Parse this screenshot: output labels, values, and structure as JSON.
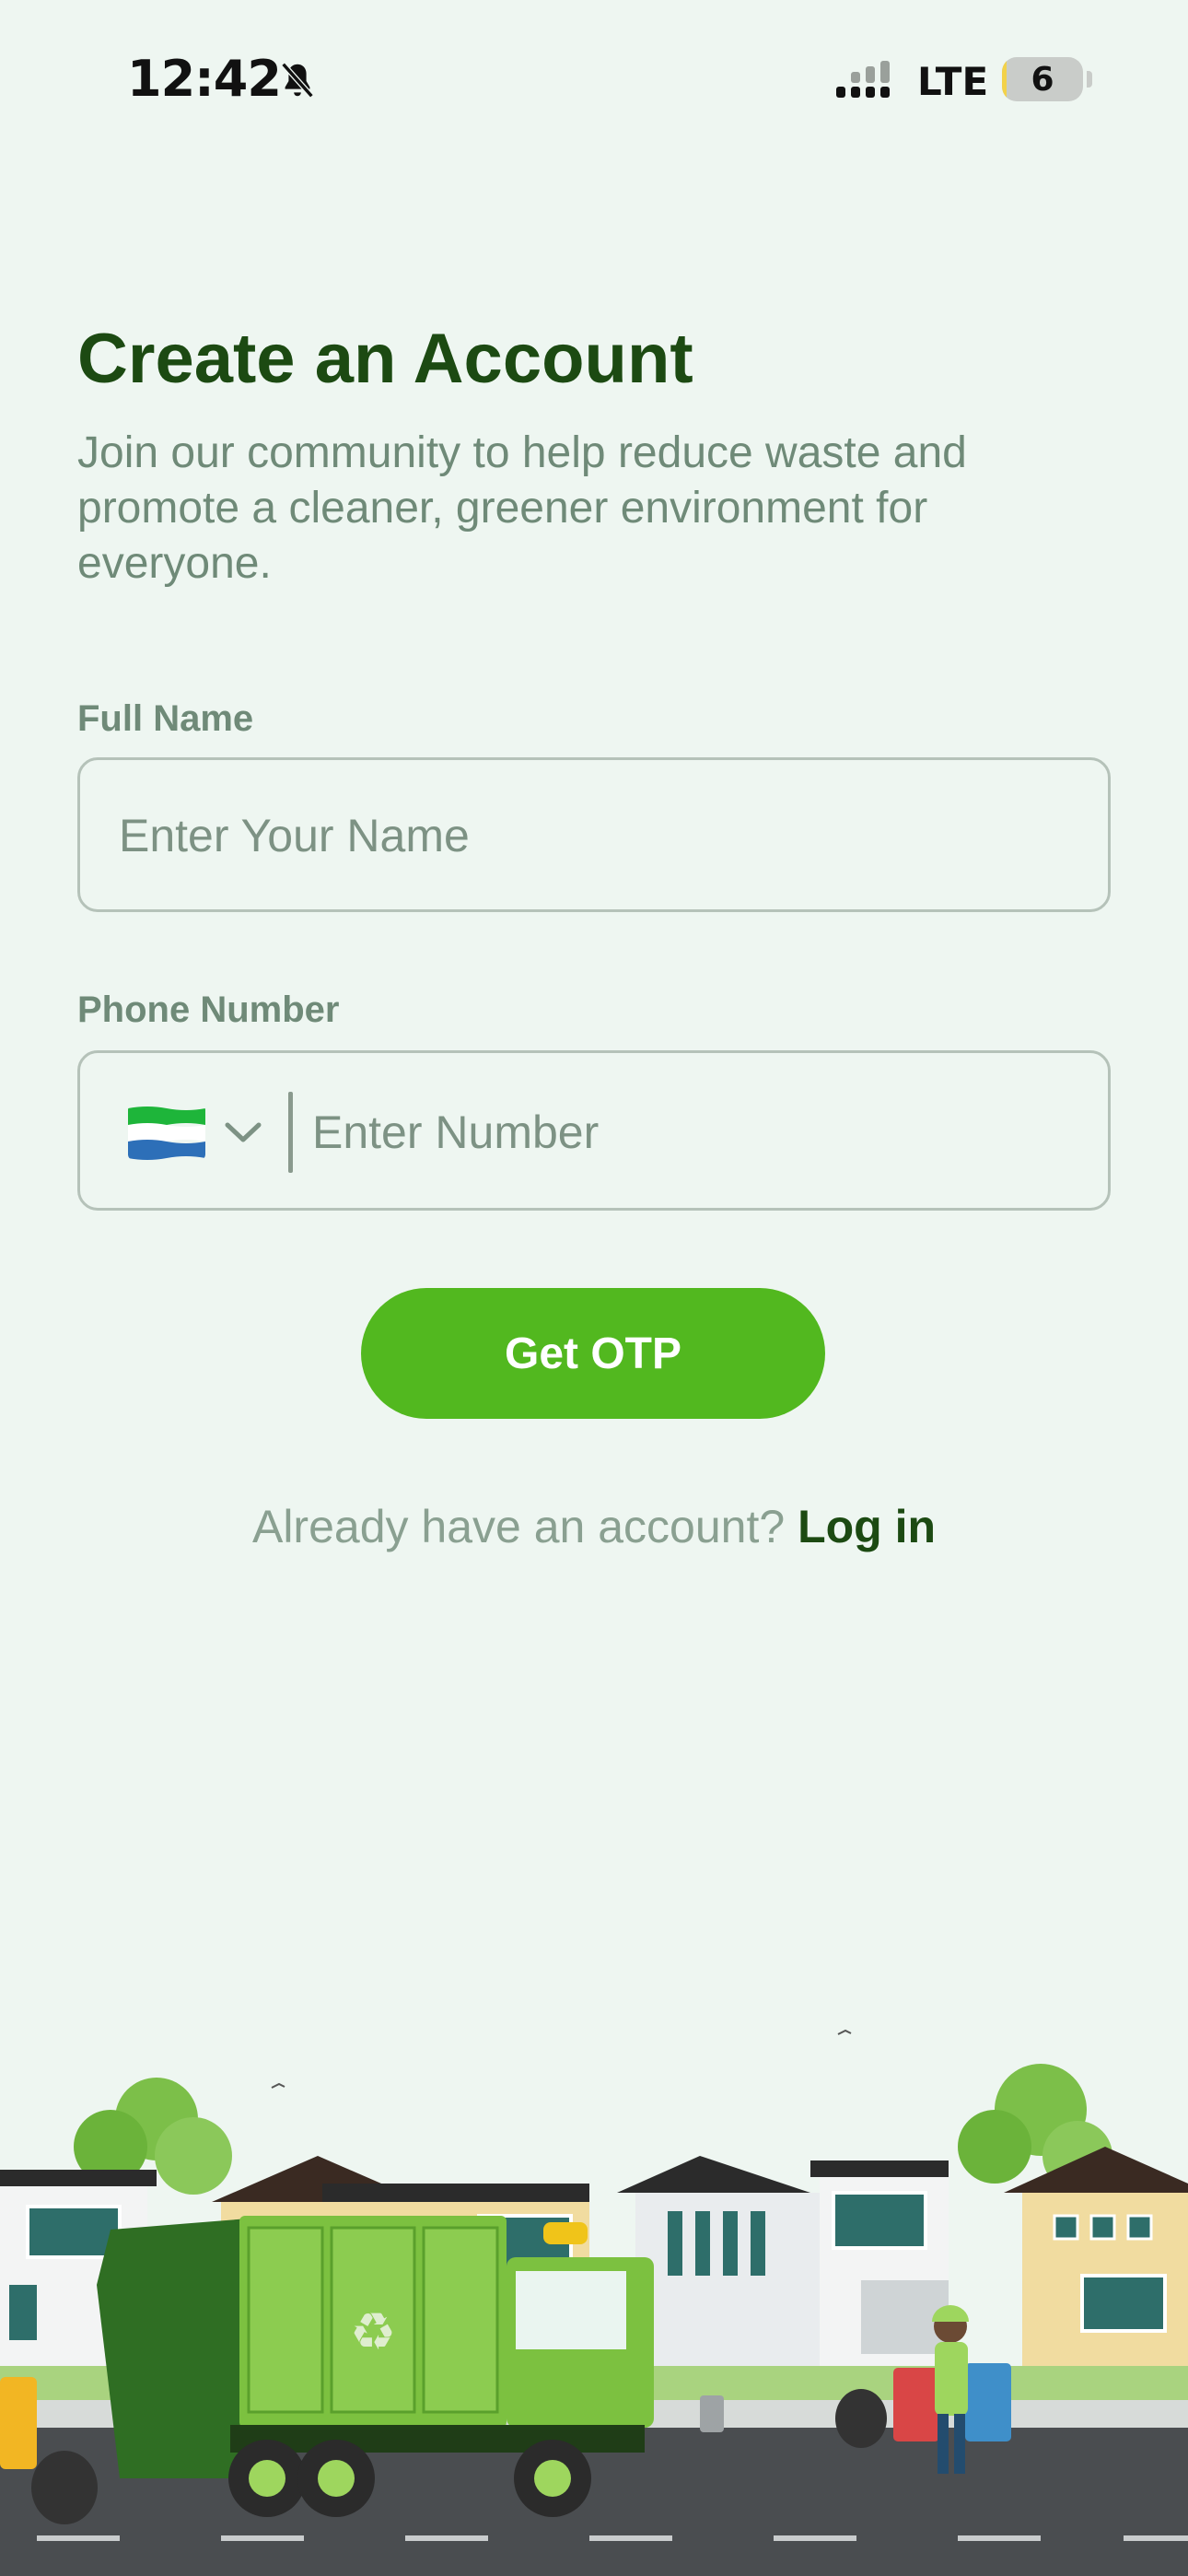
{
  "status_bar": {
    "time": "12:42",
    "network": "LTE",
    "battery_level": "6",
    "battery_fraction": 0.06,
    "icons": [
      "bell-slash-icon",
      "signal-icon",
      "battery-icon"
    ]
  },
  "header": {
    "title": "Create an Account",
    "subtitle": "Join our community to help reduce waste and promote a cleaner, greener environment for everyone."
  },
  "form": {
    "full_name": {
      "label": "Full Name",
      "value": "",
      "placeholder": "Enter Your Name"
    },
    "phone": {
      "label": "Phone Number",
      "country_flag": "sierra-leone-flag-icon",
      "value": "",
      "placeholder": "Enter Number"
    },
    "submit_label": "Get OTP"
  },
  "footer": {
    "prompt": "Already have an account?",
    "login_label": "Log in"
  },
  "colors": {
    "background": "#eef6f1",
    "title": "#1c4a12",
    "muted_text": "#6f8a78",
    "primary_button": "#52b81f",
    "field_border": "#b5c2b9"
  },
  "illustration": {
    "description_icons": [
      "garbage-truck-icon",
      "recycling-worker-icon",
      "houses-icon",
      "trees-icon",
      "recycle-bins-icon"
    ]
  }
}
